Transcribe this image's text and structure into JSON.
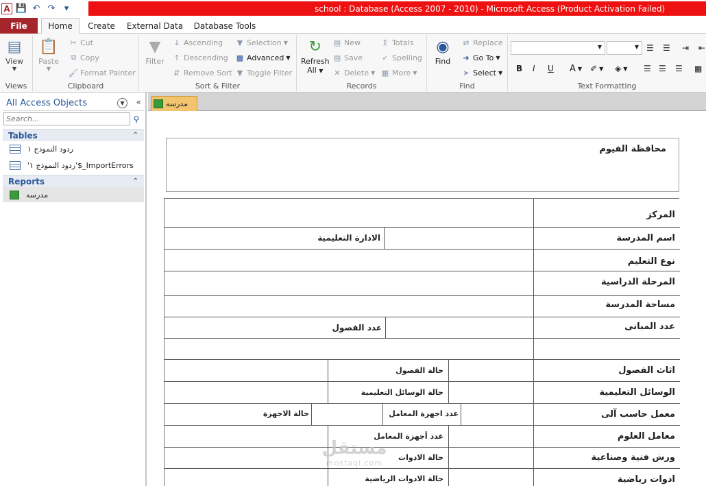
{
  "window": {
    "title": "school : Database (Access 2007 - 2010)  -  Microsoft Access (Product Activation Failed)",
    "app_letter": "A"
  },
  "tabs": [
    "File",
    "Home",
    "Create",
    "External Data",
    "Database Tools"
  ],
  "ribbon": {
    "views": {
      "view_label": "View",
      "group_label": "Views"
    },
    "clipboard": {
      "paste_label": "Paste",
      "cut_label": "Cut",
      "copy_label": "Copy",
      "format_painter_label": "Format Painter",
      "group_label": "Clipboard"
    },
    "sort_filter": {
      "filter_label": "Filter",
      "ascending_label": "Ascending",
      "descending_label": "Descending",
      "remove_sort_label": "Remove Sort",
      "selection_label": "Selection",
      "advanced_label": "Advanced",
      "toggle_filter_label": "Toggle Filter",
      "group_label": "Sort & Filter"
    },
    "records": {
      "refresh_label": "Refresh",
      "refresh_sub": "All",
      "new_label": "New",
      "save_label": "Save",
      "delete_label": "Delete",
      "totals_label": "Totals",
      "spelling_label": "Spelling",
      "more_label": "More",
      "group_label": "Records"
    },
    "find": {
      "find_label": "Find",
      "replace_label": "Replace",
      "goto_label": "Go To",
      "select_label": "Select",
      "group_label": "Find"
    },
    "text_formatting": {
      "bold": "B",
      "italic": "I",
      "underline": "U",
      "font_color": "A",
      "group_label": "Text Formatting"
    }
  },
  "nav": {
    "title": "All Access Objects",
    "search_placeholder": "Search...",
    "sections": [
      {
        "label": "Tables",
        "items": [
          "ردود النموذج ١",
          "'ردود النموذج ١'$_ImportErrors"
        ]
      },
      {
        "label": "Reports",
        "items": [
          "مدرسه"
        ]
      }
    ]
  },
  "document": {
    "tab_label": "مدرسه",
    "header_title": "محافظة الفيوم",
    "rows": [
      {
        "label": "المركز"
      },
      {
        "label": "اسم المدرسة",
        "value": "الادارة التعليمية"
      },
      {
        "label": "نوع التعليم"
      },
      {
        "label": "المرحلة الدراسية"
      },
      {
        "label": "مساحة المدرسة"
      },
      {
        "label": "عدد المبانى",
        "value": "عدد الفصول"
      },
      {
        "label": ""
      },
      {
        "label": "اثاث الفصول",
        "value": "حالة الفصول"
      },
      {
        "label": "الوسائل التعليمية",
        "value": "حالة الوسائل التعليمية"
      },
      {
        "label": "معمل حاسب آلى",
        "value": "عدد اجهزة المعامل",
        "value2": "حالة الاجهزة"
      },
      {
        "label": "معامل العلوم",
        "value": "عدد أجهزة المعامل"
      },
      {
        "label": "ورش فنية وصناعية",
        "value": "حالة الادوات"
      },
      {
        "label": "ادوات رياضية",
        "value": "حالة الادوات الرياضية"
      }
    ]
  },
  "watermark": {
    "text": "مستقل",
    "sub": "mostaql.com"
  },
  "colors": {
    "title_bar": "#ee1111",
    "file_tab": "#a4262c",
    "accent": "#2b579a",
    "doc_tab": "#f2c46d"
  }
}
